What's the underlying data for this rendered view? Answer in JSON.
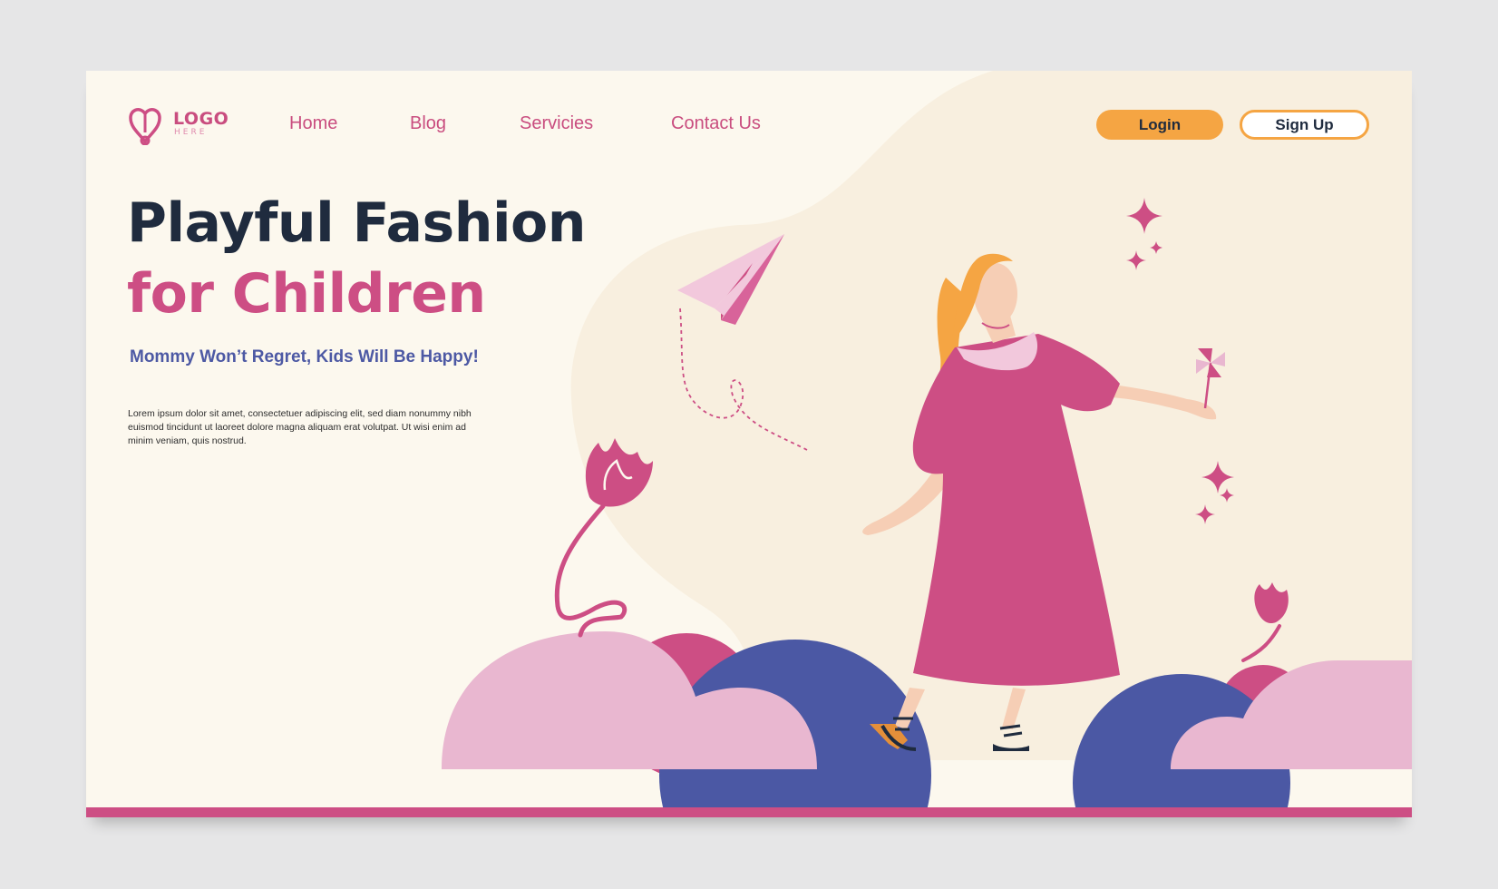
{
  "logo": {
    "text": "LOGO",
    "subtext": "HERE"
  },
  "nav": {
    "items": [
      {
        "label": "Home"
      },
      {
        "label": "Blog"
      },
      {
        "label": "Servicies"
      },
      {
        "label": "Contact Us"
      }
    ]
  },
  "auth": {
    "login_label": "Login",
    "signup_label": "Sign Up"
  },
  "hero": {
    "title_line1": "Playful Fashion",
    "title_line2": "for Children",
    "tagline": "Mommy Won’t Regret, Kids Will Be Happy!",
    "body": "Lorem ipsum dolor sit amet, consectetuer adipiscing elit, sed diam nonummy nibh euismod tincidunt ut laoreet dolore magna aliquam erat volutpat. Ut wisi enim ad minim veniam, quis nostrud."
  },
  "colors": {
    "background": "#fcf8ee",
    "page": "#e6e6e7",
    "pink": "#cd4e84",
    "light_pink": "#e9b7d0",
    "navy": "#1f2b3e",
    "blue": "#4b58a4",
    "orange": "#f5a543",
    "blob": "#f8efdf"
  },
  "icons": {
    "logo": "heart-logo-icon",
    "plane": "paper-plane-icon",
    "pinwheel": "pinwheel-icon",
    "sparkles": "sparkle-icon",
    "flower": "tulip-icon"
  }
}
